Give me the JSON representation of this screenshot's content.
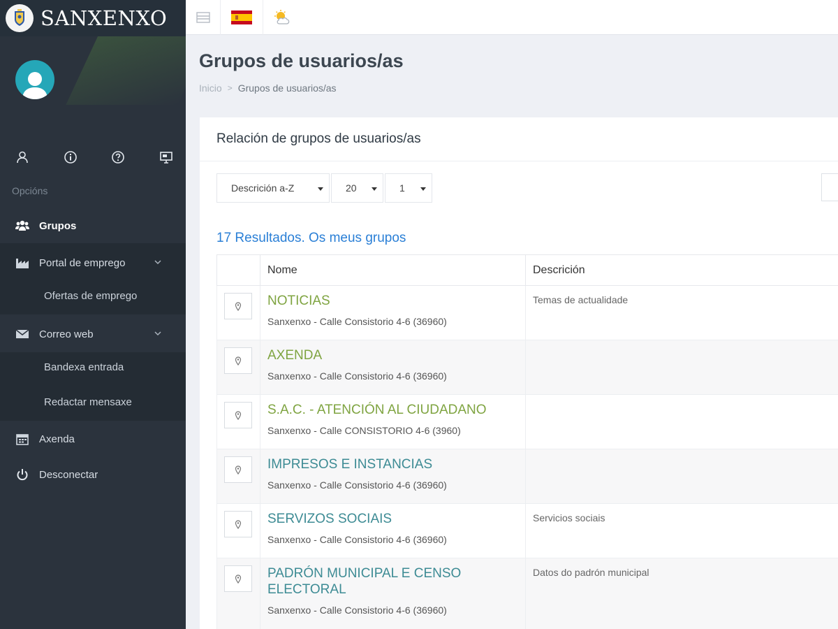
{
  "brand": {
    "name": "SANXENXO"
  },
  "sidebar": {
    "section_label": "Opcións",
    "items": [
      {
        "label": "Grupos",
        "icon": "users-icon",
        "active": true
      },
      {
        "label": "Portal de emprego",
        "icon": "industry-icon",
        "expandable": true,
        "children": [
          {
            "label": "Ofertas de emprego"
          }
        ]
      },
      {
        "label": "Correo web",
        "icon": "envelope-icon",
        "expandable": true,
        "children": [
          {
            "label": "Bandexa entrada"
          },
          {
            "label": "Redactar mensaxe"
          }
        ]
      },
      {
        "label": "Axenda",
        "icon": "calendar-icon"
      },
      {
        "label": "Desconectar",
        "icon": "power-icon"
      }
    ],
    "quick_icons": [
      "user-icon",
      "info-icon",
      "help-icon",
      "presentation-icon"
    ]
  },
  "topbar": {
    "icons": [
      "menu-toggle-icon",
      "spain-flag-icon",
      "weather-icon"
    ]
  },
  "header": {
    "title": "Grupos de usuarios/as",
    "breadcrumb": {
      "home": "Inicio",
      "current": "Grupos de usuarios/as"
    }
  },
  "panel": {
    "title": "Relación de grupos de usuarios/as",
    "filters": {
      "sort": "Descrición a-Z",
      "page_size": "20",
      "page": "1"
    },
    "results_text": "17 Resultados. Os meus grupos",
    "columns": {
      "name": "Nome",
      "description": "Descrición"
    },
    "rows": [
      {
        "name": "NOTICIAS",
        "address": "Sanxenxo - Calle Consistorio 4-6 (36960)",
        "description": "Temas de actualidade"
      },
      {
        "name": "AXENDA",
        "address": "Sanxenxo - Calle Consistorio 4-6 (36960)",
        "description": ""
      },
      {
        "name": "S.A.C. - ATENCIÓN AL CIUDADANO",
        "address": "Sanxenxo - Calle CONSISTORIO 4-6 (3960)",
        "description": ""
      },
      {
        "name": "IMPRESOS E INSTANCIAS",
        "address": "Sanxenxo - Calle Consistorio 4-6 (36960)",
        "description": ""
      },
      {
        "name": "SERVIZOS SOCIAIS",
        "address": "Sanxenxo - Calle Consistorio 4-6 (36960)",
        "description": "Servicios sociais"
      },
      {
        "name": "PADRÓN MUNICIPAL E CENSO ELECTORAL",
        "address": "Sanxenxo - Calle Consistorio 4-6 (36960)",
        "description": "Datos do padrón municipal"
      }
    ]
  },
  "colors": {
    "sidebar": "#2b333d",
    "link_green": "#7fa441",
    "link_teal": "#3d8b94",
    "results_blue": "#2a7fd6",
    "avatar": "#25a7b8"
  }
}
